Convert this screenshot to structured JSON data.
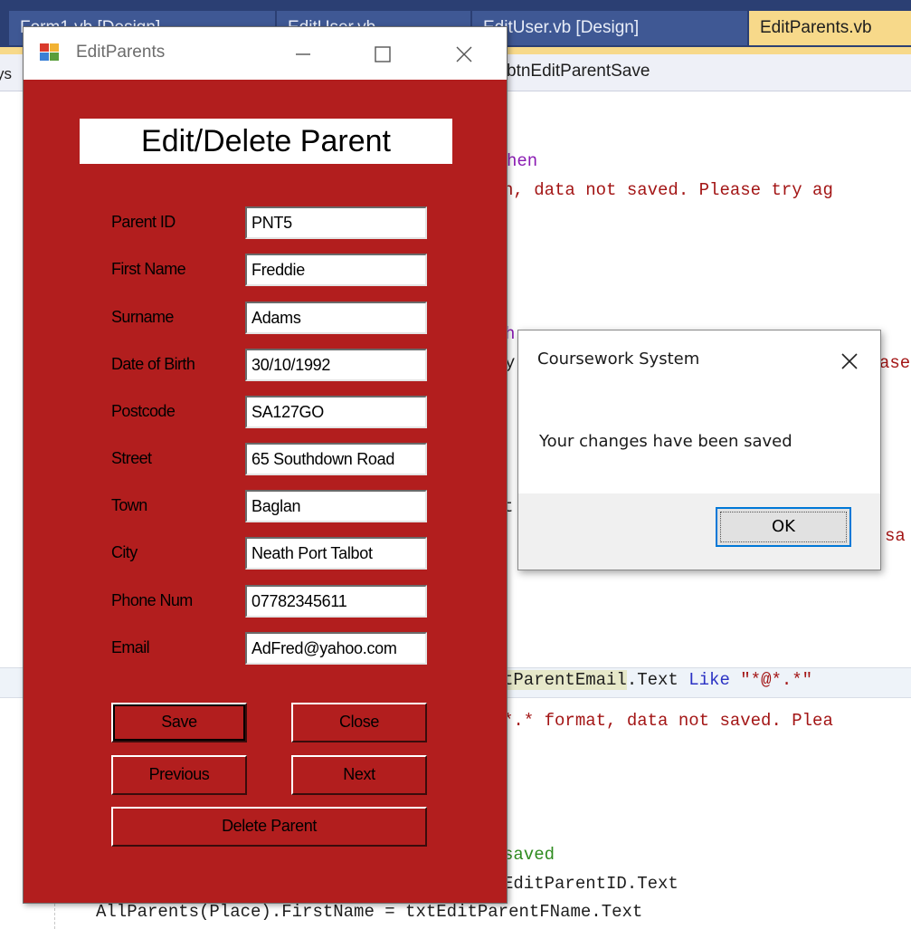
{
  "ide": {
    "tabs": [
      {
        "label": "Form1.vb [Design]"
      },
      {
        "label": "EditUser.vb"
      },
      {
        "label": "EditUser.vb [Design]"
      },
      {
        "label": "EditParents.vb"
      }
    ],
    "nav_left": "ys",
    "nav_dropdown": "btnEditParentSave",
    "code_lines": [
      {
        "kind": "kw2",
        "text": "hen"
      },
      {
        "kind": "str",
        "text": "n, data not saved. Please try ag"
      },
      {
        "kind": "kw2",
        "text": "h"
      },
      {
        "kind": "plain",
        "text": "y"
      },
      {
        "kind": "str",
        "text": "ase"
      },
      {
        "kind": "plain",
        "text": "t"
      },
      {
        "kind": "str",
        "text": "sa"
      },
      {
        "a": "tParentEmail",
        "b": ".Text ",
        "c": "Like",
        "d": "\"*@*.*\""
      },
      {
        "kind": "str",
        "text": "*.* format, data not saved. Plea"
      },
      {
        "kind": "cm",
        "text": "saved"
      },
      {
        "kind": "plain",
        "text": "EditParentID.Text"
      },
      {
        "kind": "plain",
        "text": "AllParents(Place).FirstName = txtEditParentFName.Text"
      }
    ]
  },
  "form": {
    "title": "EditParents",
    "heading": "Edit/Delete Parent",
    "fields": [
      {
        "label": "Parent ID",
        "value": "PNT5"
      },
      {
        "label": "First Name",
        "value": "Freddie"
      },
      {
        "label": "Surname",
        "value": "Adams"
      },
      {
        "label": "Date of Birth",
        "value": "30/10/1992"
      },
      {
        "label": "Postcode",
        "value": "SA127GO"
      },
      {
        "label": "Street",
        "value": "65 Southdown Road"
      },
      {
        "label": "Town",
        "value": "Baglan"
      },
      {
        "label": "City",
        "value": "Neath Port Talbot"
      },
      {
        "label": "Phone Num",
        "value": "07782345611"
      },
      {
        "label": "Email",
        "value": "AdFred@yahoo.com"
      }
    ],
    "buttons": {
      "save": "Save",
      "close": "Close",
      "previous": "Previous",
      "next": "Next",
      "delete": "Delete Parent"
    },
    "colors": {
      "background": "#b21e1e"
    }
  },
  "message_box": {
    "title": "Coursework System",
    "text": "Your changes have been saved",
    "ok": "OK"
  }
}
